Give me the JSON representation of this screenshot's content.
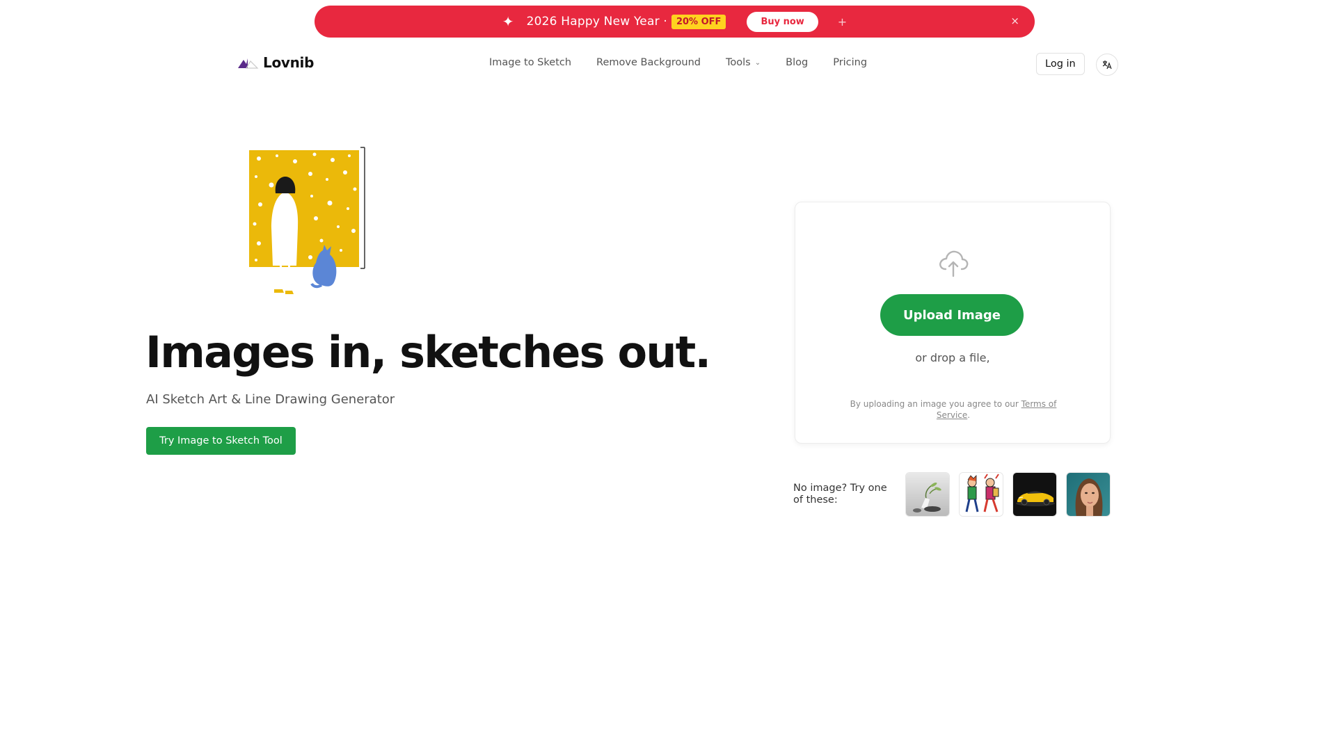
{
  "promo": {
    "message": "2026 Happy New Year ·",
    "discount": "20% OFF",
    "buy_label": "Buy now",
    "plus_glyph": "+",
    "close_glyph": "×",
    "sparkle_glyph": "✦",
    "bg_color": "#e8283f",
    "badge_color": "#ffd21f"
  },
  "nav": {
    "brand": "Lovnib",
    "links": [
      {
        "label": "Image to Sketch"
      },
      {
        "label": "Remove Background"
      },
      {
        "label": "Tools",
        "chevron": "⌄"
      },
      {
        "label": "Blog"
      },
      {
        "label": "Pricing"
      }
    ],
    "login_label": "Log in",
    "language_icon": "translate-icon"
  },
  "hero": {
    "title": "Images in, sketches out.",
    "subtitle": "AI Sketch Art & Line Drawing Generator",
    "cta_label": "Try Image to Sketch Tool",
    "accent_color": "#1e9e47"
  },
  "upload": {
    "icon": "cloud-upload-icon",
    "button_label": "Upload Image",
    "drop_text": "or drop a file,",
    "terms_prefix": "By uploading an image you agree to our ",
    "terms_link": "Terms of Service",
    "terms_suffix": "."
  },
  "samples": {
    "label": "No image? Try one of these:",
    "thumbnails": [
      "plant-still-life",
      "cartoon-kids",
      "yellow-sports-car",
      "woman-portrait"
    ]
  }
}
